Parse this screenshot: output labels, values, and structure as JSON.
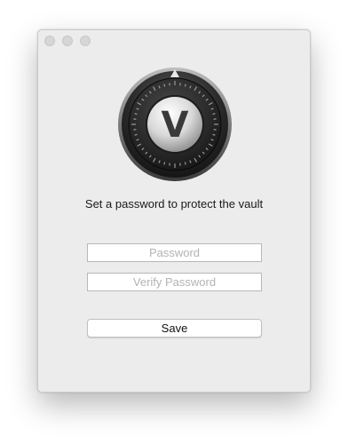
{
  "window": {
    "traffic_lights": [
      "close-button",
      "minimize-button",
      "zoom-button"
    ]
  },
  "logo": {
    "icon": "vault-dial-icon",
    "letter": "V"
  },
  "prompt": {
    "text": "Set a password to protect the vault"
  },
  "fields": {
    "password_placeholder": "Password",
    "verify_placeholder": "Verify Password"
  },
  "actions": {
    "save_label": "Save"
  },
  "colors": {
    "window_background": "#ececec",
    "dial_dark": "#2a2a2a",
    "dial_light": "#e0e0e0"
  }
}
